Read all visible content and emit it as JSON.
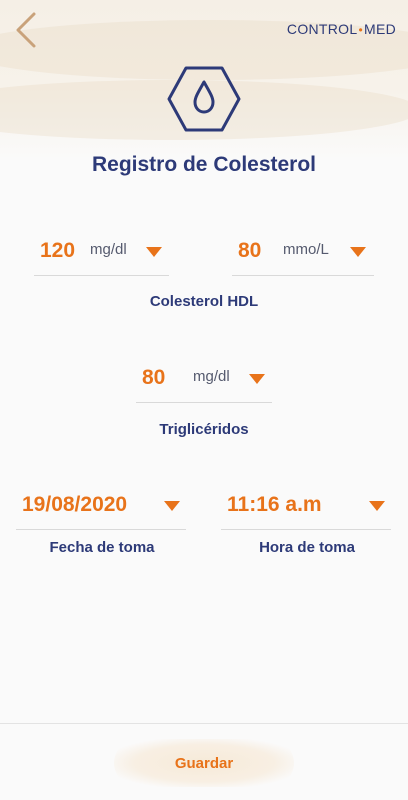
{
  "header": {
    "brand_left": "CONTROL",
    "brand_dot": "•",
    "brand_right": "MED"
  },
  "page": {
    "title": "Registro de Colesterol"
  },
  "hdl": {
    "value_1": "120",
    "unit_1": "mg/dl",
    "value_2": "80",
    "unit_2": "mmo/L",
    "caption": "Colesterol HDL"
  },
  "triglycerides": {
    "value": "80",
    "unit": "mg/dl",
    "caption": "Triglicéridos"
  },
  "date": {
    "value": "19/08/2020",
    "caption": "Fecha de toma"
  },
  "time": {
    "value": "11:16 a.m",
    "caption": "Hora de toma"
  },
  "footer": {
    "save_label": "Guardar"
  },
  "colors": {
    "accent": "#e8731a",
    "navy": "#2d3a78",
    "back_arrow": "#c9a27a"
  },
  "icons": {
    "back": "chevron-left-icon",
    "drop": "drop-icon",
    "dropdown": "caret-down-icon"
  }
}
